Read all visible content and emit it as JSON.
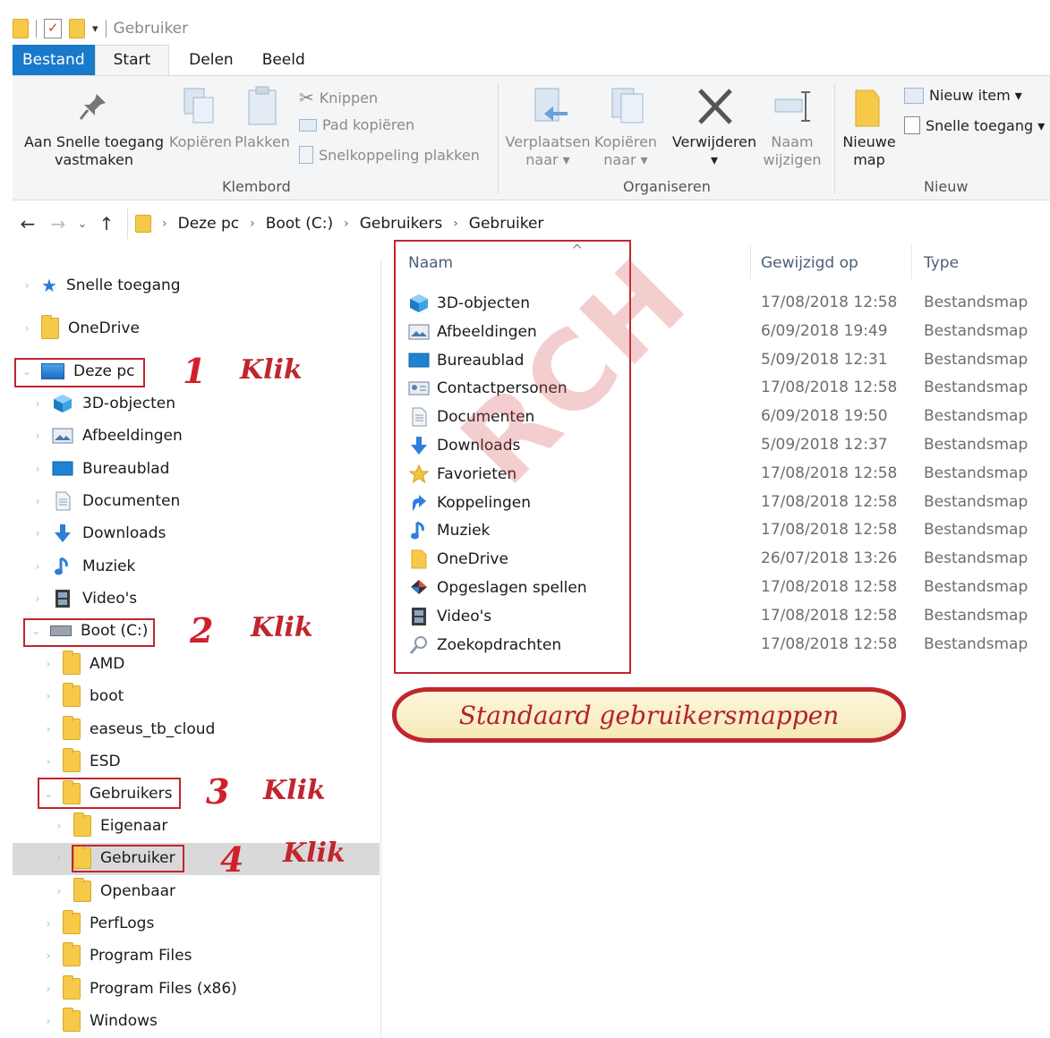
{
  "window": {
    "title": "Gebruiker"
  },
  "tabs": [
    "Bestand",
    "Start",
    "Delen",
    "Beeld"
  ],
  "ribbon": {
    "clipboard": {
      "pin": "Aan Snelle toegang vastmaken",
      "pin_line1": "Aan Snelle toegang",
      "pin_line2": "vastmaken",
      "copy": "Kopiëren",
      "paste": "Plakken",
      "cut": "Knippen",
      "copy_path": "Pad kopiëren",
      "paste_shortcut": "Snelkoppeling plakken",
      "group": "Klembord"
    },
    "organize": {
      "move_line1": "Verplaatsen",
      "move_line2": "naar ▾",
      "copy_line1": "Kopiëren",
      "copy_line2": "naar ▾",
      "delete": "Verwijderen",
      "delete_arrow": "▾",
      "rename_line1": "Naam",
      "rename_line2": "wijzigen",
      "group": "Organiseren"
    },
    "new": {
      "new_folder_line1": "Nieuwe",
      "new_folder_line2": "map",
      "new_item": "Nieuw item ▾",
      "easy_access": "Snelle toegang ▾",
      "group": "Nieuw"
    }
  },
  "address": {
    "crumbs": [
      "Deze pc",
      "Boot (C:)",
      "Gebruikers",
      "Gebruiker"
    ]
  },
  "nav": {
    "quick_access": "Snelle toegang",
    "onedrive": "OneDrive",
    "this_pc": "Deze pc",
    "pc_items": [
      "3D-objecten",
      "Afbeeldingen",
      "Bureaublad",
      "Documenten",
      "Downloads",
      "Muziek",
      "Video's"
    ],
    "boot": "Boot (C:)",
    "c_items": [
      "AMD",
      "boot",
      "easeus_tb_cloud",
      "ESD"
    ],
    "users": "Gebruikers",
    "user_items": [
      "Eigenaar",
      "Gebruiker",
      "Openbaar"
    ],
    "c_items2": [
      "PerfLogs",
      "Program Files",
      "Program Files (x86)",
      "Windows"
    ]
  },
  "annotations": {
    "n1": "1",
    "n2": "2",
    "n3": "3",
    "n4": "4",
    "klik": "Klik",
    "callout": "Standaard gebruikersmappen",
    "watermark": "RCH"
  },
  "columns": {
    "name": "Naam",
    "sort_arrow": "^",
    "modified": "Gewijzigd op",
    "type": "Type"
  },
  "files": [
    {
      "name": "3D-objecten",
      "date": "17/08/2018 12:58",
      "type": "Bestandsmap",
      "icon": "cube-icon"
    },
    {
      "name": "Afbeeldingen",
      "date": "6/09/2018 19:49",
      "type": "Bestandsmap",
      "icon": "pictures-icon"
    },
    {
      "name": "Bureaublad",
      "date": "5/09/2018 12:31",
      "type": "Bestandsmap",
      "icon": "desktop-icon"
    },
    {
      "name": "Contactpersonen",
      "date": "17/08/2018 12:58",
      "type": "Bestandsmap",
      "icon": "contacts-icon"
    },
    {
      "name": "Documenten",
      "date": "6/09/2018 19:50",
      "type": "Bestandsmap",
      "icon": "document-icon"
    },
    {
      "name": "Downloads",
      "date": "5/09/2018 12:37",
      "type": "Bestandsmap",
      "icon": "download-icon"
    },
    {
      "name": "Favorieten",
      "date": "17/08/2018 12:58",
      "type": "Bestandsmap",
      "icon": "star-icon"
    },
    {
      "name": "Koppelingen",
      "date": "17/08/2018 12:58",
      "type": "Bestandsmap",
      "icon": "link-icon"
    },
    {
      "name": "Muziek",
      "date": "17/08/2018 12:58",
      "type": "Bestandsmap",
      "icon": "music-icon"
    },
    {
      "name": "OneDrive",
      "date": "26/07/2018 13:26",
      "type": "Bestandsmap",
      "icon": "folder-icon"
    },
    {
      "name": "Opgeslagen spellen",
      "date": "17/08/2018 12:58",
      "type": "Bestandsmap",
      "icon": "games-icon"
    },
    {
      "name": "Video's",
      "date": "17/08/2018 12:58",
      "type": "Bestandsmap",
      "icon": "video-icon"
    },
    {
      "name": "Zoekopdrachten",
      "date": "17/08/2018 12:58",
      "type": "Bestandsmap",
      "icon": "search-icon"
    }
  ],
  "colors": {
    "accent": "#1979ca",
    "annotation_red": "#c0262d",
    "folder_yellow": "#f7c948"
  }
}
